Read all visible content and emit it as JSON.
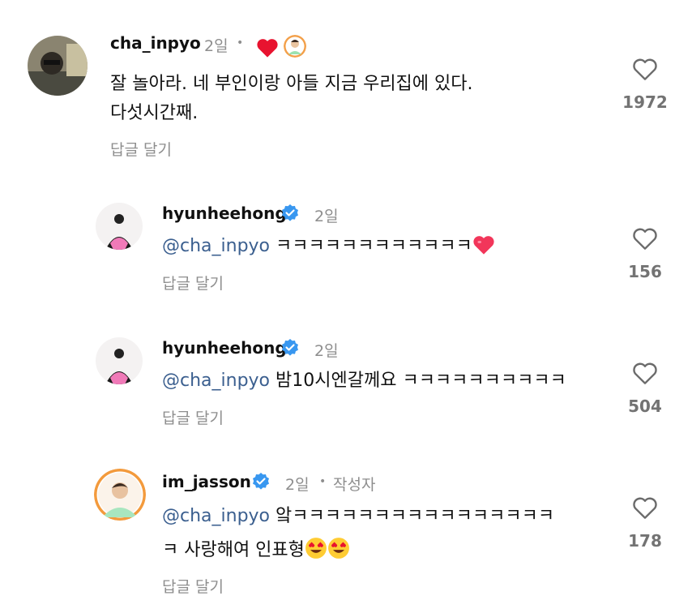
{
  "comments": [
    {
      "username": "cha_inpyo",
      "time": "2일",
      "line1": "잘 놀아라. 네 부인이랑 아들 지금 우리집에 있다.",
      "line2": "다섯시간째.",
      "reply": "답글 달기",
      "likes": "1972"
    },
    {
      "username": "hyunheehong",
      "time": "2일",
      "mention": "@cha_inpyo",
      "text": " ㅋㅋㅋㅋㅋㅋㅋㅋㅋㅋㅋㅋ",
      "reply": "답글 달기",
      "likes": "156"
    },
    {
      "username": "hyunheehong",
      "time": "2일",
      "mention": "@cha_inpyo",
      "text": " 밤10시엔갈께요 ㅋㅋㅋㅋㅋㅋㅋㅋㅋㅋ",
      "reply": "답글 달기",
      "likes": "504"
    },
    {
      "username": "im_jasson",
      "time": "2일",
      "author_tag": "작성자",
      "mention": "@cha_inpyo",
      "line1_text": " 앜ㅋㅋㅋㅋㅋㅋㅋㅋㅋㅋㅋㅋㅋㅋㅋㅋ",
      "line2": "ㅋ 사랑해여 인표형",
      "reply": "답글 달기",
      "likes": "178"
    }
  ],
  "colors": {
    "mention": "#3b5f8f",
    "muted": "#8e8e8e",
    "verified": "#3897f0",
    "heart": "#e8132f"
  },
  "icons": [
    "heart-outline-icon",
    "verified-badge-icon",
    "red-heart-icon",
    "heart-emoji",
    "heart-eyes-emoji"
  ]
}
